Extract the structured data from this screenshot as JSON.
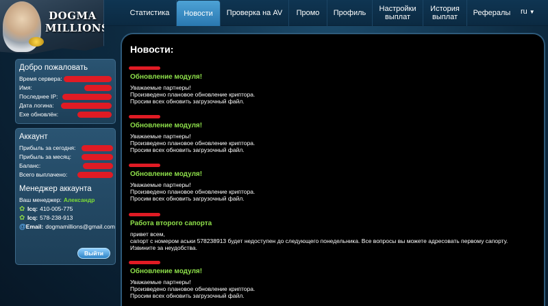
{
  "logo": {
    "line1": "DOGMA",
    "line2": "MILLIONS"
  },
  "nav": [
    {
      "label": "Статистика",
      "active": false
    },
    {
      "label": "Новости",
      "active": true
    },
    {
      "label": "Проверка на AV",
      "active": false
    },
    {
      "label": "Промо",
      "active": false
    },
    {
      "label": "Профиль",
      "active": false
    },
    {
      "label": "Настройки выплат",
      "active": false
    },
    {
      "label": "История выплат",
      "active": false
    },
    {
      "label": "Рефералы",
      "active": false
    }
  ],
  "lang": "ru",
  "welcome": {
    "title": "Добро пожаловать",
    "fields": [
      "Время сервера:",
      "Имя:",
      "Последнее IP:",
      "Дата логина:",
      "Exe обновлён:"
    ]
  },
  "account": {
    "title": "Аккаунт",
    "fields": [
      "Прибыль за сегодня:",
      "Прибыль за месяц:",
      "Баланс:",
      "Всего выплачено:"
    ]
  },
  "manager": {
    "title": "Менеджер аккаунта",
    "label": "Ваш менеджер:",
    "name": "Александр",
    "icq_label": "Icq:",
    "icq1": "410-005-775",
    "icq2": "578-238-913",
    "email_label": "Email:",
    "email": "dogmamillions@gmail.com"
  },
  "logout_button": "Выйти",
  "page_title": "Новости:",
  "news": [
    {
      "title": "Обновление модуля!",
      "lines": [
        "Уважаемые партнеры!",
        "Произведено плановое обновление криптора.",
        "Просим всех обновить загрузочный файл."
      ]
    },
    {
      "title": "Обновление модуля!",
      "lines": [
        "Уважаемые партнеры!",
        "Произведено плановое обновление криптора.",
        "Просим всех обновить загрузочный файл."
      ]
    },
    {
      "title": "Обновление модуля!",
      "lines": [
        "Уважаемые партнеры!",
        "Произведено плановое обновление криптора.",
        "Просим всех обновить загрузочный файл."
      ]
    },
    {
      "title": "Работа второго сапорта",
      "lines": [
        "привет всем,",
        "сапорт с номером аськи  578238913 будет недоступен до следующего понедельника. Все вопросы вы можете адресовать первому сапорту.",
        "Извините за неудобства."
      ]
    },
    {
      "title": "Обновление модуля!",
      "lines": [
        "Уважаемые партнеры!",
        "Произведено плановое обновление криптора.",
        "Просим всех обновить загрузочный файл."
      ]
    }
  ],
  "colors": {
    "accent_green": "#8ee04a",
    "redaction": "#e01b24",
    "active_tab": "#2a78b0"
  }
}
